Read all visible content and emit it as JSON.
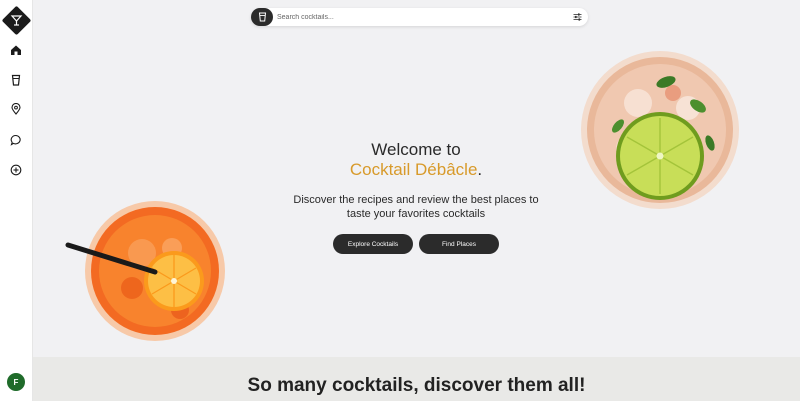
{
  "sidebar": {
    "logo": "cocktail-glass-logo",
    "items": [
      {
        "name": "home",
        "icon": "home-icon"
      },
      {
        "name": "cocktails",
        "icon": "glass-icon"
      },
      {
        "name": "places",
        "icon": "location-pin-icon"
      },
      {
        "name": "reviews",
        "icon": "chat-bubble-icon"
      },
      {
        "name": "add",
        "icon": "plus-circle-icon"
      }
    ],
    "avatar_initial": "F",
    "avatar_color": "#1f6b2a"
  },
  "search": {
    "placeholder": "Search cocktails...",
    "value": "",
    "leading_icon": "glass-icon",
    "trailing_icon": "filter-sliders-icon"
  },
  "hero": {
    "title_line1": "Welcome to",
    "brand": "Cocktail Débâcle",
    "brand_suffix": ".",
    "description": "Discover the recipes and review the best places to taste your favorites cocktails",
    "explore_button": "Explore Cocktails",
    "places_button": "Find Places"
  },
  "images": {
    "left": "orange-spritz-cocktail",
    "right": "mojito-lime-cocktail"
  },
  "section": {
    "title": "So many cocktails, discover them all!"
  },
  "colors": {
    "accent": "#d89a2a",
    "dark": "#2b2b2b",
    "background": "#f1f1f3"
  }
}
